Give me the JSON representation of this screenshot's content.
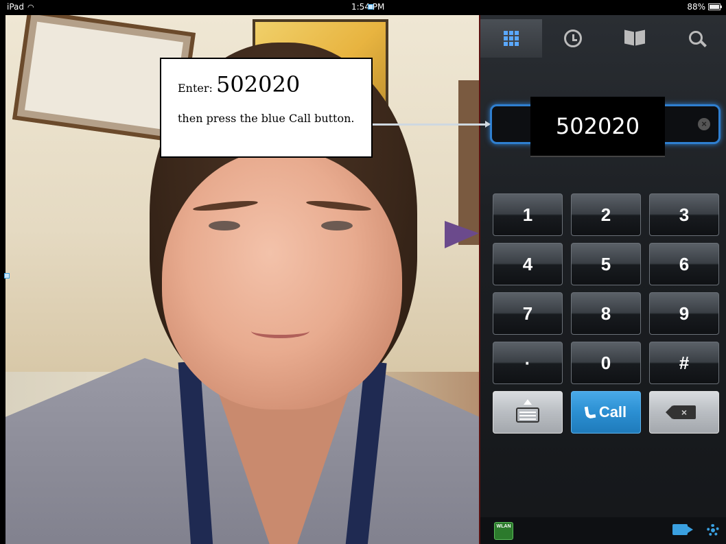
{
  "status_bar": {
    "device": "iPad",
    "time": "1:54 PM",
    "battery": "88%"
  },
  "callout": {
    "prefix": "Enter:",
    "number": "502020",
    "instruction": "then press the blue Call button."
  },
  "dialer": {
    "tabs": [
      {
        "name": "keypad-icon",
        "active": true
      },
      {
        "name": "history-icon",
        "active": false
      },
      {
        "name": "contacts-book-icon",
        "active": false
      },
      {
        "name": "search-icon",
        "active": false
      }
    ],
    "entered_number": "502020",
    "keys": [
      "1",
      "2",
      "3",
      "4",
      "5",
      "6",
      "7",
      "8",
      "9",
      "·",
      "0",
      "#"
    ],
    "call_label": "Call",
    "call_color": "#2b8fd2",
    "field_border_color": "#2f7fd0",
    "bottom_bar": {
      "wlan_label": "WLAN"
    }
  }
}
